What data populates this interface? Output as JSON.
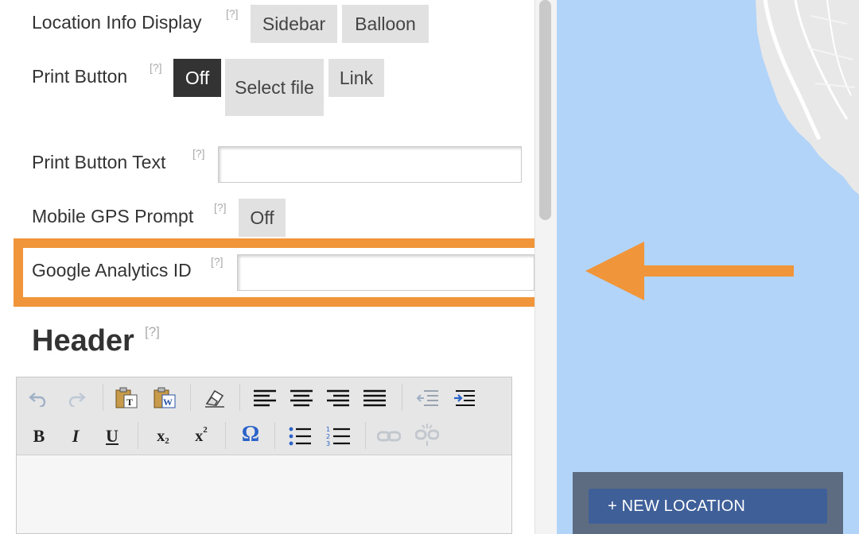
{
  "settings": {
    "location_info": {
      "label": "Location Info Display",
      "help": "[?]",
      "options": [
        "Sidebar",
        "Balloon"
      ]
    },
    "print_button": {
      "label": "Print Button",
      "help": "[?]",
      "options": [
        "Off",
        "Select file",
        "Link"
      ],
      "selected": "Off"
    },
    "print_button_text": {
      "label": "Print Button Text",
      "help": "[?]",
      "value": ""
    },
    "mobile_gps": {
      "label": "Mobile GPS Prompt",
      "help": "[?]",
      "value": "Off"
    },
    "google_analytics": {
      "label": "Google Analytics ID",
      "help": "[?]",
      "value": ""
    }
  },
  "header": {
    "title": "Header",
    "help": "[?]"
  },
  "editor": {
    "toolbar_row1": [
      "undo-icon",
      "redo-icon",
      "paste-text-icon",
      "paste-word-icon",
      "remove-format-icon",
      "align-left-icon",
      "align-center-icon",
      "align-right-icon",
      "justify-icon",
      "outdent-icon",
      "indent-icon"
    ],
    "toolbar_row2": [
      "bold-icon",
      "italic-icon",
      "underline-icon",
      "subscript-icon",
      "superscript-icon",
      "special-char-icon",
      "bulleted-list-icon",
      "numbered-list-icon",
      "link-icon",
      "unlink-icon"
    ]
  },
  "map": {
    "new_location_label": "+ NEW LOCATION"
  },
  "colors": {
    "highlight": "#f0953a",
    "map_water": "#b3d4f9",
    "button_blue": "#3f5f99"
  }
}
